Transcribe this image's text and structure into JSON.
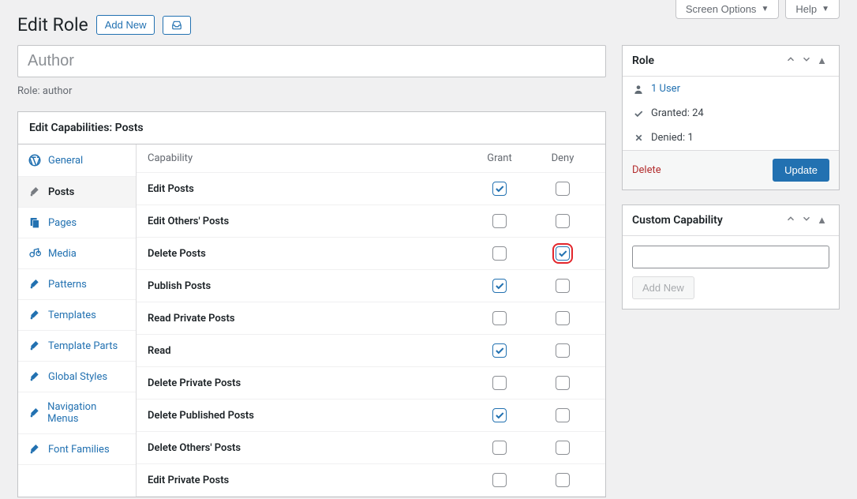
{
  "top": {
    "screen_options": "Screen Options",
    "help": "Help"
  },
  "header": {
    "title": "Edit Role",
    "add_new": "Add New"
  },
  "role_name_value": "Author",
  "role_slug_label": "Role:",
  "role_slug_value": "author",
  "panel_title": "Edit Capabilities: Posts",
  "sidebar_items": [
    {
      "label": "General",
      "icon": "wp"
    },
    {
      "label": "Posts",
      "icon": "pin",
      "active": true
    },
    {
      "label": "Pages",
      "icon": "pages"
    },
    {
      "label": "Media",
      "icon": "media"
    },
    {
      "label": "Patterns",
      "icon": "pin"
    },
    {
      "label": "Templates",
      "icon": "pin"
    },
    {
      "label": "Template Parts",
      "icon": "pin"
    },
    {
      "label": "Global Styles",
      "icon": "pin"
    },
    {
      "label": "Navigation Menus",
      "icon": "pin"
    },
    {
      "label": "Font Families",
      "icon": "pin"
    }
  ],
  "cap_headers": {
    "name": "Capability",
    "grant": "Grant",
    "deny": "Deny"
  },
  "capabilities": [
    {
      "name": "Edit Posts",
      "grant": true,
      "deny": false
    },
    {
      "name": "Edit Others' Posts",
      "grant": false,
      "deny": false
    },
    {
      "name": "Delete Posts",
      "grant": false,
      "deny": true,
      "highlight_deny": true
    },
    {
      "name": "Publish Posts",
      "grant": true,
      "deny": false
    },
    {
      "name": "Read Private Posts",
      "grant": false,
      "deny": false
    },
    {
      "name": "Read",
      "grant": true,
      "deny": false
    },
    {
      "name": "Delete Private Posts",
      "grant": false,
      "deny": false
    },
    {
      "name": "Delete Published Posts",
      "grant": true,
      "deny": false
    },
    {
      "name": "Delete Others' Posts",
      "grant": false,
      "deny": false
    },
    {
      "name": "Edit Private Posts",
      "grant": false,
      "deny": false
    }
  ],
  "role_box": {
    "title": "Role",
    "user_count": "1 User",
    "granted": "Granted: 24",
    "denied": "Denied: 1",
    "delete": "Delete",
    "update": "Update"
  },
  "cc_box": {
    "title": "Custom Capability",
    "add_new": "Add New"
  }
}
